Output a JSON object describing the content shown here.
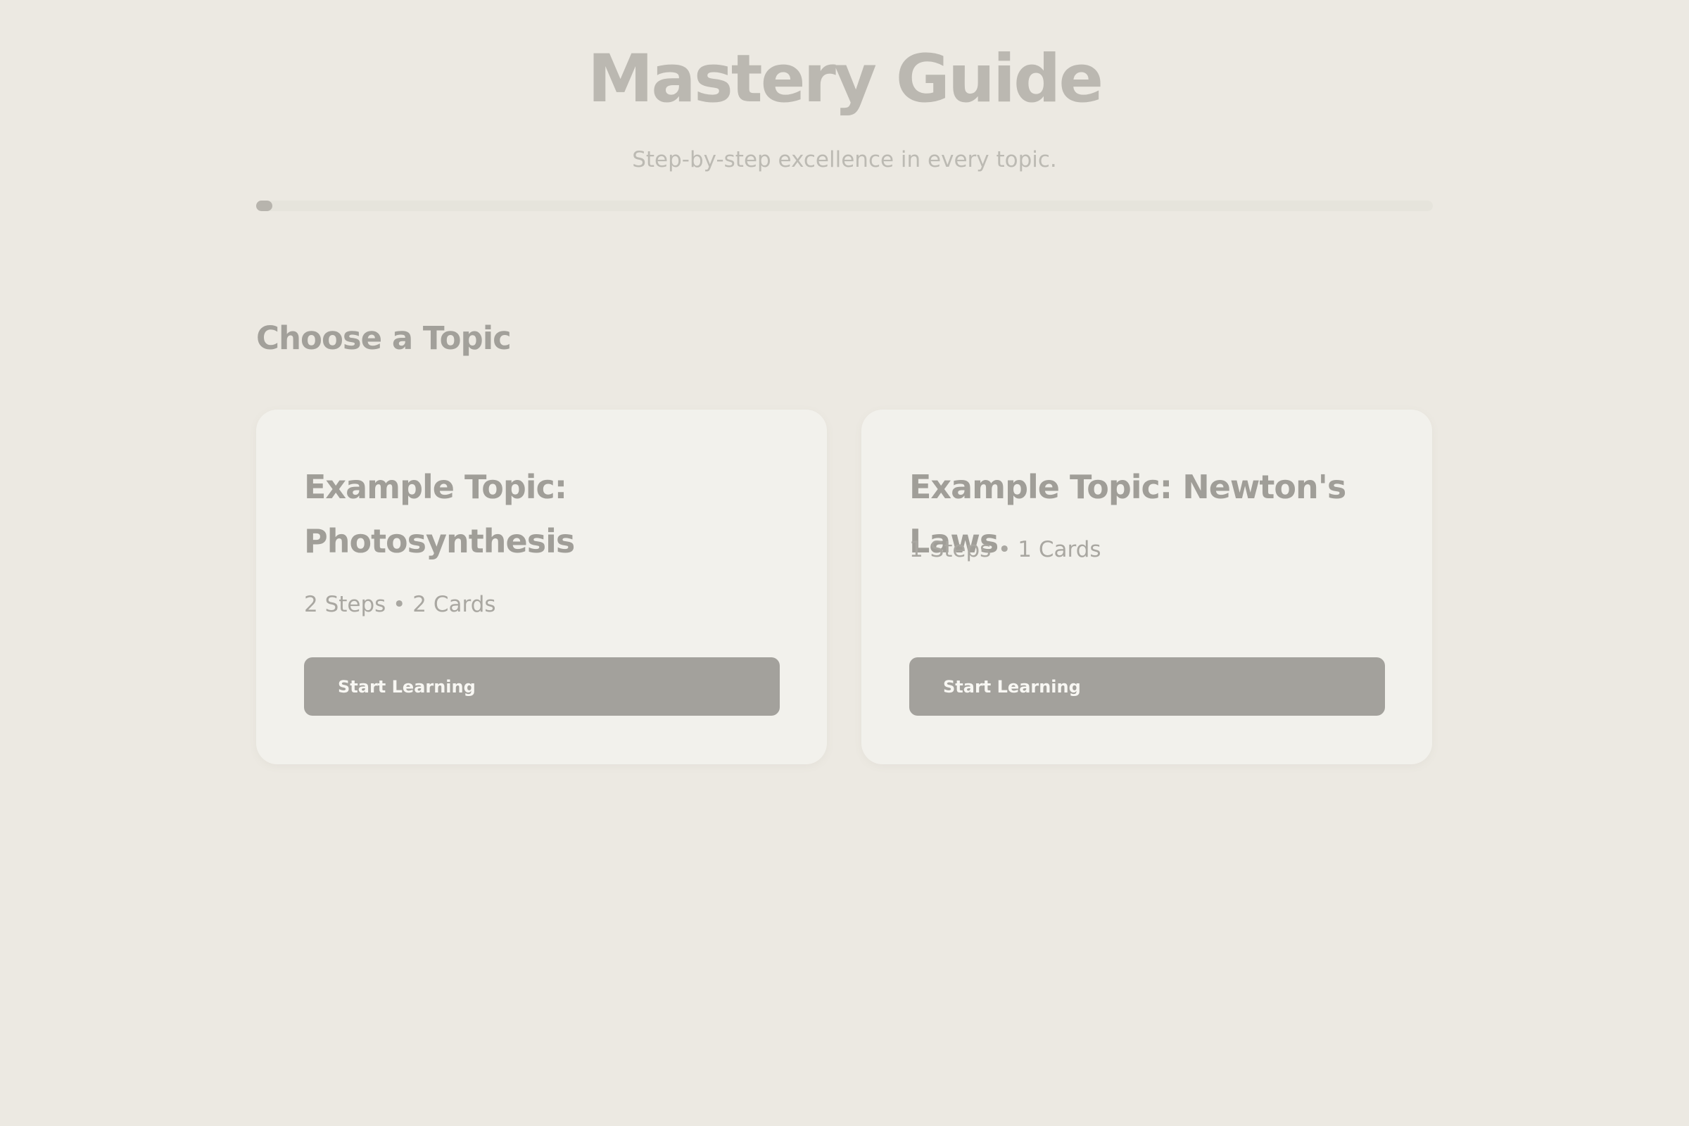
{
  "header": {
    "title": "Mastery Guide",
    "subtitle": "Step-by-step excellence in every topic.",
    "progress": 0.014
  },
  "main": {
    "section_title": "Choose a Topic",
    "topics": [
      {
        "title": "Example Topic: Photosynthesis",
        "meta": "2 Steps • 2 Cards",
        "button_label": "Start Learning"
      },
      {
        "title": "Example Topic: Newton's Laws",
        "meta": "1 Steps • 1 Cards",
        "button_label": "Start Learning"
      }
    ]
  },
  "colors": {
    "background": "#ece9e2",
    "card": "#f2f1ec",
    "button": "#a3a19c",
    "title": "#bbb8b1"
  }
}
